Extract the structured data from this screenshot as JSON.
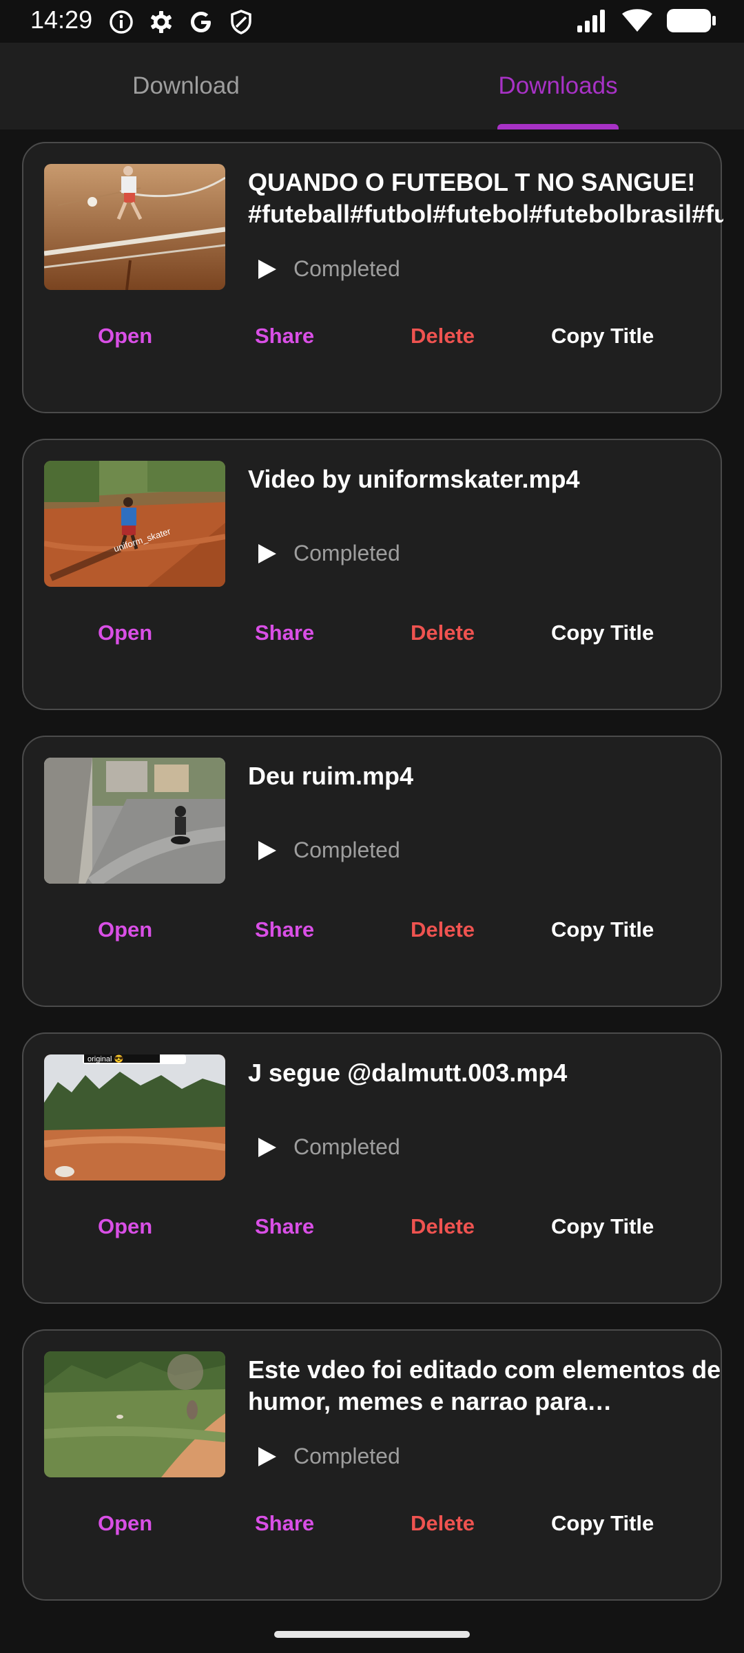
{
  "status_bar": {
    "time": "14:29"
  },
  "tabs": [
    {
      "label": "Download",
      "active": false
    },
    {
      "label": "Downloads",
      "active": true
    }
  ],
  "colors": {
    "accent": "#a832c6",
    "action_pink": "#d94fe6",
    "delete_red": "#ef5350",
    "card_bg": "#1f1f1f",
    "page_bg": "#131313"
  },
  "actions": {
    "open": "Open",
    "share": "Share",
    "delete": "Delete",
    "copy_title": "Copy Title"
  },
  "downloads": [
    {
      "title": "QUANDO O FUTEBOL T NO SANGUE! #futeball#futbol#futebol#futebolbrasil#fut",
      "status": "Completed",
      "thumbnail": "indoor-futsal-court"
    },
    {
      "title": "Video by uniformskater.mp4",
      "status": "Completed",
      "thumbnail": "dirt-road-skater",
      "thumbnail_text": "uniform_skater"
    },
    {
      "title": "Deu ruim.mp4",
      "status": "Completed",
      "thumbnail": "street-motorcycle"
    },
    {
      "title": "J segue  @dalmutt.003.mp4",
      "status": "Completed",
      "thumbnail": "dirt-field-trees",
      "thumbnail_text": "original 😎"
    },
    {
      "title": "Este vdeo foi editado com elementos de humor, memes e narrao para transformar o momento",
      "status": "Completed",
      "thumbnail": "grass-field-birds"
    }
  ]
}
